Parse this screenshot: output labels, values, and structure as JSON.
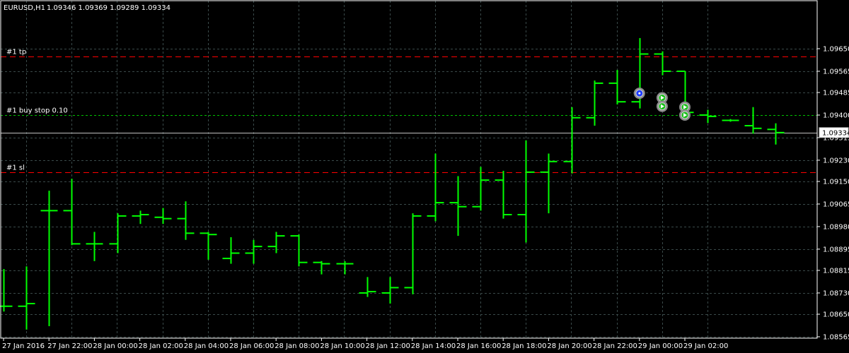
{
  "header": {
    "symbol": "EURUSD,H1",
    "ohlc": "1.09346 1.09369 1.09289 1.09334"
  },
  "colors": {
    "background": "#000000",
    "grid": "#3a4a4a",
    "bar": "#00ff00",
    "tp_sl": "#ff0000",
    "entry": "#00c000",
    "bid_line": "#c0c0c0",
    "frame": "#ffffff"
  },
  "chart_data": {
    "type": "ohlc",
    "ylim": [
      1.08565,
      1.09735
    ],
    "y_ticks": [
      "1.09650",
      "1.09565",
      "1.09485",
      "1.09400",
      "1.09315",
      "1.09230",
      "1.09150",
      "1.09065",
      "1.08980",
      "1.08895",
      "1.08815",
      "1.08730",
      "1.08650",
      "1.08565"
    ],
    "x_labels": [
      {
        "bar": 0,
        "label": "27 Jan 2016"
      },
      {
        "bar": 2,
        "label": "27 Jan 22:00"
      },
      {
        "bar": 4,
        "label": "28 Jan 00:00"
      },
      {
        "bar": 6,
        "label": "28 Jan 02:00"
      },
      {
        "bar": 8,
        "label": "28 Jan 04:00"
      },
      {
        "bar": 10,
        "label": "28 Jan 06:00"
      },
      {
        "bar": 12,
        "label": "28 Jan 08:00"
      },
      {
        "bar": 14,
        "label": "28 Jan 10:00"
      },
      {
        "bar": 16,
        "label": "28 Jan 12:00"
      },
      {
        "bar": 18,
        "label": "28 Jan 14:00"
      },
      {
        "bar": 20,
        "label": "28 Jan 16:00"
      },
      {
        "bar": 22,
        "label": "28 Jan 18:00"
      },
      {
        "bar": 24,
        "label": "28 Jan 20:00"
      },
      {
        "bar": 26,
        "label": "28 Jan 22:00"
      },
      {
        "bar": 28,
        "label": "29 Jan 00:00"
      },
      {
        "bar": 30,
        "label": "29 Jan 02:00"
      }
    ],
    "bars": [
      {
        "o": 1.0868,
        "h": 1.0882,
        "l": 1.0866,
        "c": 1.0868
      },
      {
        "o": 1.0868,
        "h": 1.0883,
        "l": 1.08592,
        "c": 1.0869
      },
      {
        "o": 1.0904,
        "h": 1.09115,
        "l": 1.08605,
        "c": 1.0904
      },
      {
        "o": 1.0904,
        "h": 1.0916,
        "l": 1.0891,
        "c": 1.08915
      },
      {
        "o": 1.08915,
        "h": 1.0896,
        "l": 1.0885,
        "c": 1.08915
      },
      {
        "o": 1.08915,
        "h": 1.0903,
        "l": 1.0888,
        "c": 1.0902
      },
      {
        "o": 1.0902,
        "h": 1.0904,
        "l": 1.0899,
        "c": 1.09025
      },
      {
        "o": 1.09015,
        "h": 1.0905,
        "l": 1.0899,
        "c": 1.0901
      },
      {
        "o": 1.0901,
        "h": 1.09075,
        "l": 1.0893,
        "c": 1.08955
      },
      {
        "o": 1.08955,
        "h": 1.0896,
        "l": 1.08855,
        "c": 1.0895
      },
      {
        "o": 1.0886,
        "h": 1.0894,
        "l": 1.0884,
        "c": 1.0888
      },
      {
        "o": 1.0888,
        "h": 1.0893,
        "l": 1.0884,
        "c": 1.08905
      },
      {
        "o": 1.08905,
        "h": 1.0896,
        "l": 1.0888,
        "c": 1.08945
      },
      {
        "o": 1.08945,
        "h": 1.0895,
        "l": 1.0883,
        "c": 1.08845
      },
      {
        "o": 1.08845,
        "h": 1.0885,
        "l": 1.088,
        "c": 1.0884
      },
      {
        "o": 1.0884,
        "h": 1.0885,
        "l": 1.088,
        "c": 1.0884
      },
      {
        "o": 1.0873,
        "h": 1.0879,
        "l": 1.08715,
        "c": 1.08735
      },
      {
        "o": 1.0873,
        "h": 1.0879,
        "l": 1.0869,
        "c": 1.0875
      },
      {
        "o": 1.0875,
        "h": 1.0903,
        "l": 1.08725,
        "c": 1.0902
      },
      {
        "o": 1.0902,
        "h": 1.09255,
        "l": 1.09,
        "c": 1.0907
      },
      {
        "o": 1.0907,
        "h": 1.0917,
        "l": 1.08945,
        "c": 1.09055
      },
      {
        "o": 1.09055,
        "h": 1.09205,
        "l": 1.0904,
        "c": 1.09155
      },
      {
        "o": 1.09155,
        "h": 1.0919,
        "l": 1.0901,
        "c": 1.09025
      },
      {
        "o": 1.09025,
        "h": 1.09305,
        "l": 1.0892,
        "c": 1.09185
      },
      {
        "o": 1.09185,
        "h": 1.09255,
        "l": 1.0903,
        "c": 1.09225
      },
      {
        "o": 1.09225,
        "h": 1.0943,
        "l": 1.0918,
        "c": 1.0939
      },
      {
        "o": 1.0939,
        "h": 1.0953,
        "l": 1.0936,
        "c": 1.0952
      },
      {
        "o": 1.0952,
        "h": 1.0957,
        "l": 1.0944,
        "c": 1.0945
      },
      {
        "o": 1.0945,
        "h": 1.0969,
        "l": 1.09425,
        "c": 1.0963
      },
      {
        "o": 1.0963,
        "h": 1.0964,
        "l": 1.0955,
        "c": 1.09565
      },
      {
        "o": 1.09565,
        "h": 1.09565,
        "l": 1.09395,
        "c": 1.0941
      },
      {
        "o": 1.094,
        "h": 1.0942,
        "l": 1.0937,
        "c": 1.09395
      },
      {
        "o": 1.0938,
        "h": 1.09385,
        "l": 1.09375,
        "c": 1.0938
      },
      {
        "o": 1.0936,
        "h": 1.0943,
        "l": 1.0933,
        "c": 1.0935
      },
      {
        "o": 1.09346,
        "h": 1.09369,
        "l": 1.09289,
        "c": 1.09334
      }
    ],
    "levels": [
      {
        "name": "tp",
        "label": "#1 tp",
        "price": 1.0962
      },
      {
        "name": "buy-stop",
        "label": "#1 buy stop 0.10",
        "price": 1.094
      },
      {
        "name": "sl",
        "label": "#1 sl",
        "price": 1.09185
      }
    ],
    "bid": {
      "price": 1.09334,
      "label": "1.09334"
    },
    "markers": [
      {
        "bar": 28,
        "price": 1.09482,
        "kind": "blue"
      },
      {
        "bar": 29,
        "price": 1.09465,
        "kind": "green"
      },
      {
        "bar": 29,
        "price": 1.09433,
        "kind": "green"
      },
      {
        "bar": 30,
        "price": 1.0943,
        "kind": "green"
      },
      {
        "bar": 30,
        "price": 1.094,
        "kind": "green"
      }
    ]
  }
}
